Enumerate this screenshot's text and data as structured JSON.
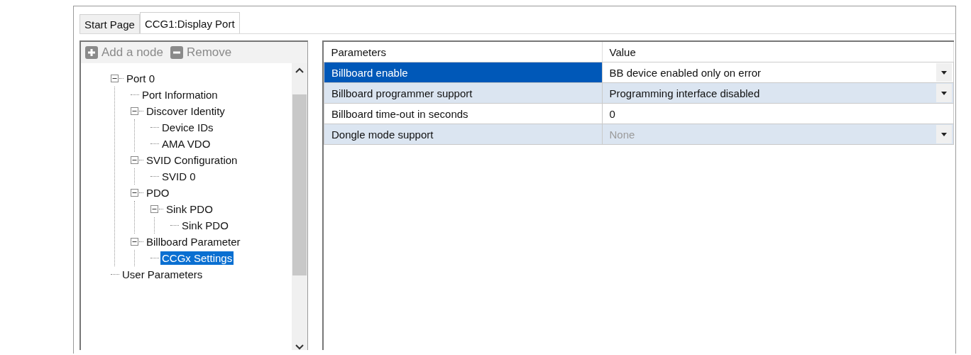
{
  "tabs": [
    {
      "label": "Start Page",
      "selected": false
    },
    {
      "label": "CCG1:Display Port",
      "selected": true
    }
  ],
  "toolbar": [
    {
      "label": "Add a node",
      "kind": "add",
      "disabled": true
    },
    {
      "label": "Remove",
      "kind": "remove",
      "disabled": true
    }
  ],
  "tree": [
    {
      "label": "Port 0",
      "expanded": true,
      "selected": false,
      "children": [
        {
          "label": "Port Information",
          "selected": false
        },
        {
          "label": "Discover Identity",
          "expanded": true,
          "selected": false,
          "children": [
            {
              "label": "Device IDs",
              "selected": false
            },
            {
              "label": "AMA VDO",
              "selected": false
            }
          ]
        },
        {
          "label": "SVID Configuration",
          "expanded": true,
          "selected": false,
          "children": [
            {
              "label": "SVID 0",
              "selected": false
            }
          ]
        },
        {
          "label": "PDO",
          "expanded": true,
          "selected": false,
          "children": [
            {
              "label": "Sink PDO",
              "expanded": true,
              "selected": false,
              "children": [
                {
                  "label": "Sink PDO",
                  "selected": false
                }
              ]
            }
          ]
        },
        {
          "label": "Billboard Parameter",
          "expanded": true,
          "selected": false,
          "children": [
            {
              "label": "CCGx Settings",
              "selected": true
            }
          ]
        }
      ]
    },
    {
      "label": "User Parameters",
      "selected": false
    }
  ],
  "grid": {
    "columns": [
      "Parameters",
      "Value"
    ],
    "rows": [
      {
        "name": "Billboard enable",
        "value": "BB device enabled only on error",
        "kind": "dropdown",
        "selected": true,
        "disabled": false
      },
      {
        "name": "Billboard programmer support",
        "value": "Programming interface disabled",
        "kind": "dropdown",
        "selected": false,
        "disabled": false
      },
      {
        "name": "Billboard time-out in seconds",
        "value": "0",
        "kind": "text",
        "selected": false,
        "disabled": false
      },
      {
        "name": "Dongle mode support",
        "value": "None",
        "kind": "dropdown",
        "selected": false,
        "disabled": true
      }
    ]
  }
}
